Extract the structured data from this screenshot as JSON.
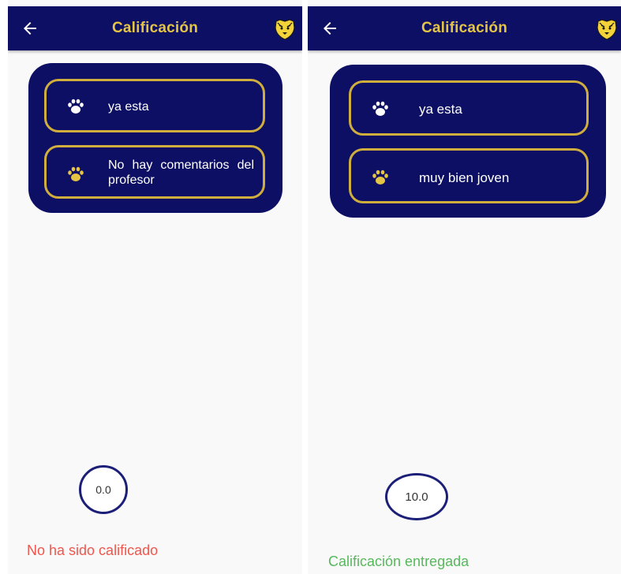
{
  "colors": {
    "navy": "#0d0f64",
    "gold": "#cfae3e",
    "title_gold": "#e4c445",
    "not_graded_red": "#f0564c",
    "graded_green": "#58b85c"
  },
  "screens": [
    {
      "appbar": {
        "title": "Calificación",
        "back_icon": "arrow-left-icon",
        "logo_icon": "tiger-logo-icon"
      },
      "items": [
        {
          "icon": "paw-icon",
          "text": "ya esta"
        },
        {
          "icon": "paw-icon",
          "text": "No hay comentarios del profesor"
        }
      ],
      "grade": "0.0",
      "status": "No ha sido calificado"
    },
    {
      "appbar": {
        "title": "Calificación",
        "back_icon": "arrow-left-icon",
        "logo_icon": "tiger-logo-icon"
      },
      "items": [
        {
          "icon": "paw-icon",
          "text": "ya esta"
        },
        {
          "icon": "paw-icon",
          "text": "muy bien joven"
        }
      ],
      "grade": "10.0",
      "status": "Calificación entregada"
    }
  ]
}
